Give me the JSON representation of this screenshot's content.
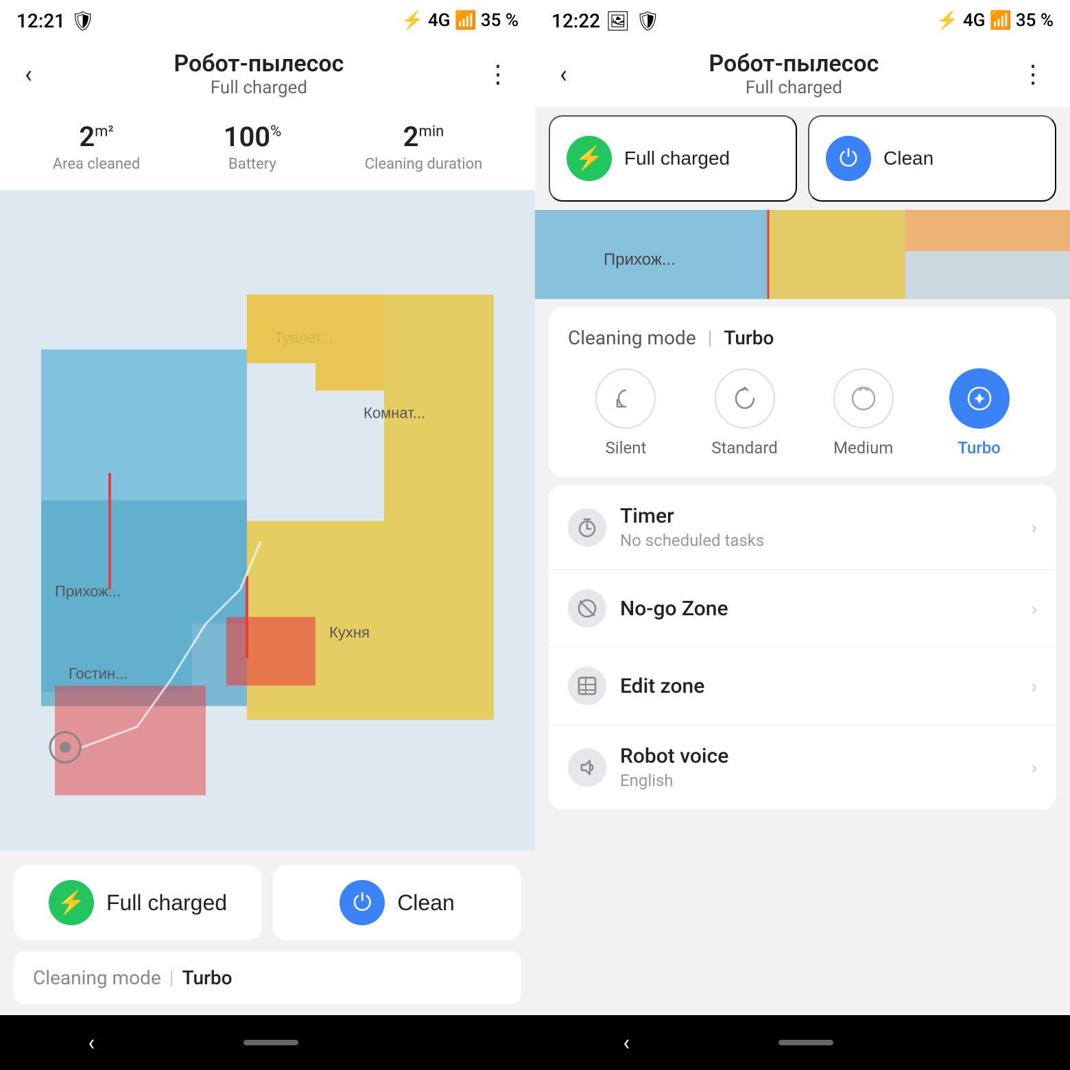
{
  "left": {
    "status_bar": {
      "time": "12:21",
      "shield_icon": "🛡",
      "signal": "4G",
      "battery": "35 %"
    },
    "top_bar": {
      "back_label": "‹",
      "title": "Робот-пылесос",
      "subtitle": "Full charged",
      "more_label": "⋮"
    },
    "stats": [
      {
        "value": "2",
        "unit": "m²",
        "label": "Area cleaned"
      },
      {
        "value": "100",
        "unit": "%",
        "label": "Battery"
      },
      {
        "value": "2",
        "unit": "min",
        "label": "Cleaning duration"
      }
    ],
    "action_buttons": [
      {
        "id": "full-charged",
        "label": "Full charged",
        "type": "green"
      },
      {
        "id": "clean",
        "label": "Clean",
        "type": "blue"
      }
    ],
    "cleaning_mode": {
      "label": "Cleaning mode",
      "separator": "|",
      "value": "Turbo"
    },
    "nav": {
      "back": "‹",
      "home_pill": ""
    }
  },
  "right": {
    "status_bar": {
      "time": "12:22",
      "shield_icon": "🛡",
      "signal": "4G",
      "battery": "35 %"
    },
    "top_bar": {
      "back_label": "‹",
      "title": "Робот-пылесос",
      "subtitle": "Full charged",
      "more_label": "⋮"
    },
    "action_buttons": [
      {
        "id": "full-charged",
        "label": "Full charged",
        "type": "green"
      },
      {
        "id": "clean",
        "label": "Clean",
        "type": "blue"
      }
    ],
    "cleaning_mode": {
      "label": "Cleaning mode",
      "separator": "|",
      "value": "Turbo",
      "modes": [
        {
          "id": "silent",
          "label": "Silent",
          "active": false
        },
        {
          "id": "standard",
          "label": "Standard",
          "active": false
        },
        {
          "id": "medium",
          "label": "Medium",
          "active": false
        },
        {
          "id": "turbo",
          "label": "Turbo",
          "active": true
        }
      ]
    },
    "list_items": [
      {
        "id": "timer",
        "title": "Timer",
        "subtitle": "No scheduled tasks",
        "icon": "⏱"
      },
      {
        "id": "nogo-zone",
        "title": "No-go Zone",
        "subtitle": "",
        "icon": "⊘"
      },
      {
        "id": "edit-zone",
        "title": "Edit zone",
        "subtitle": "",
        "icon": "⊟"
      },
      {
        "id": "robot-voice",
        "title": "Robot voice",
        "subtitle": "English",
        "icon": "🔈"
      }
    ],
    "nav": {
      "back": "‹",
      "home_pill": ""
    }
  }
}
